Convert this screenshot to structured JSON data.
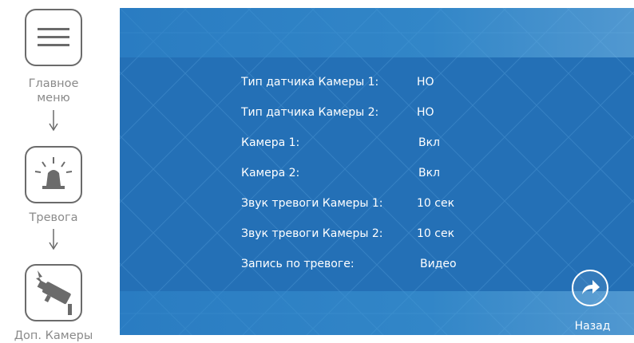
{
  "nav": {
    "items": [
      {
        "label": "Главное меню",
        "icon": "menu-icon"
      },
      {
        "label": "Тревога",
        "icon": "alarm-siren-icon"
      },
      {
        "label": "Доп. Камеры",
        "icon": "camera-icon"
      }
    ]
  },
  "settings": {
    "rows": [
      {
        "label": "Тип датчика Камеры 1:",
        "value": "НО"
      },
      {
        "label": "Тип датчика Камеры 2:",
        "value": "НО"
      },
      {
        "label": "Камера 1:",
        "value": "Вкл"
      },
      {
        "label": "Камера 2:",
        "value": "Вкл"
      },
      {
        "label": "Звук тревоги Камеры 1:",
        "value": "10 сек"
      },
      {
        "label": "Звук тревоги Камеры 2:",
        "value": "10 сек"
      },
      {
        "label": "Запись по тревоге:",
        "value": "Видео"
      }
    ]
  },
  "back": {
    "label": "Назад",
    "icon": "back-arrow-icon"
  },
  "colors": {
    "panel": "#2470b6",
    "text": "#ffffff",
    "nav_text": "#8a8a8a",
    "nav_border": "#6b6b6b"
  }
}
